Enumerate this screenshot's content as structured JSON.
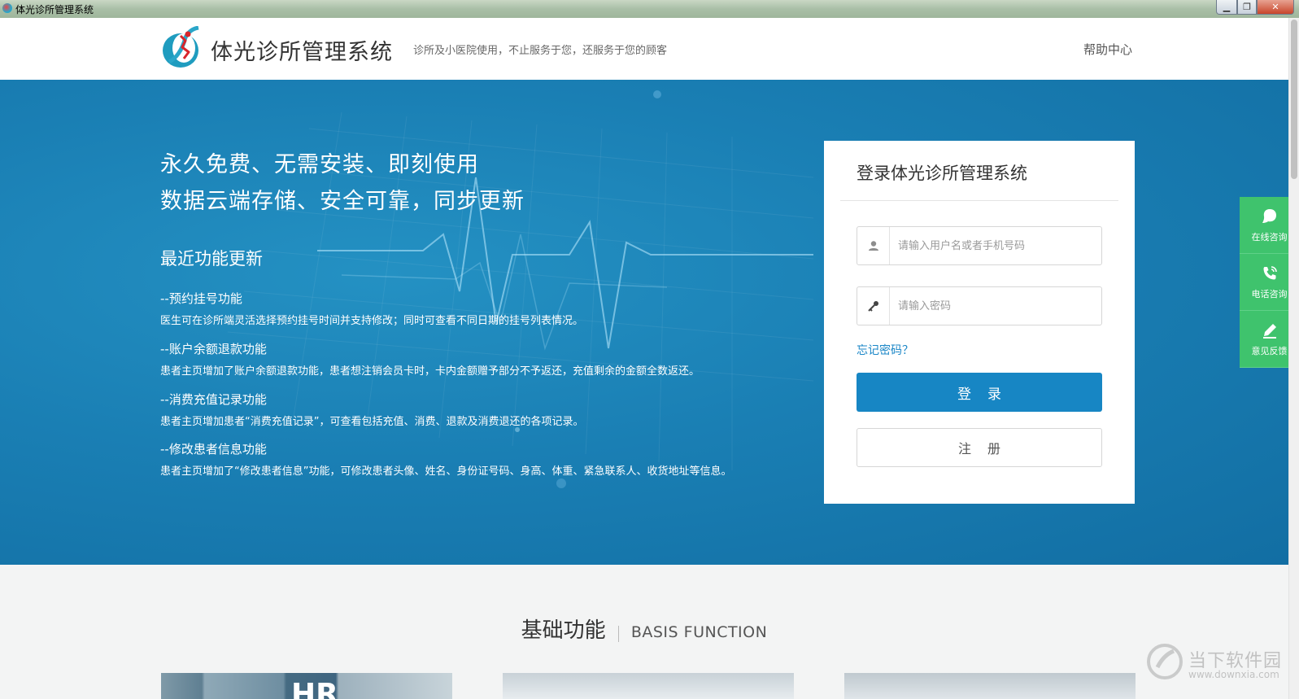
{
  "window": {
    "title": "体光诊所管理系统",
    "controls": {
      "minimize": "▁",
      "maximize": "❐",
      "close": "✕"
    }
  },
  "header": {
    "brand": "体光诊所管理系统",
    "slogan": "诊所及小医院使用，不止服务于您，还服务于您的顾客",
    "help": "帮助中心",
    "logo_icon": "clinic-logo-icon"
  },
  "hero": {
    "heading_1": "永久免费、无需安装、即刻使用",
    "heading_2": "数据云端存储、安全可靠，同步更新",
    "updates_title": "最近功能更新",
    "updates": [
      {
        "name": "--预约挂号功能",
        "desc": "医生可在诊所端灵活选择预约挂号时间并支持修改；同时可查看不同日期的挂号列表情况。"
      },
      {
        "name": "--账户余额退款功能",
        "desc": "患者主页增加了账户余额退款功能，患者想注销会员卡时，卡内金额赠予部分不予返还，充值剩余的金额全数返还。"
      },
      {
        "name": "--消费充值记录功能",
        "desc": "患者主页增加患者“消费充值记录”，可查看包括充值、消费、退款及消费退还的各项记录。"
      },
      {
        "name": "--修改患者信息功能",
        "desc": "患者主页增加了“修改患者信息”功能，可修改患者头像、姓名、身份证号码、身高、体重、紧急联系人、收货地址等信息。"
      }
    ]
  },
  "login": {
    "title": "登录体光诊所管理系统",
    "username_placeholder": "请输入用户名或者手机号码",
    "password_placeholder": "请输入密码",
    "forgot": "忘记密码？",
    "login_button": "登录",
    "register_button": "注册"
  },
  "side": [
    {
      "label": "在线咨询",
      "icon": "chat-bubble-icon"
    },
    {
      "label": "电话咨询",
      "icon": "phone-icon"
    },
    {
      "label": "意见反馈",
      "icon": "pencil-icon"
    }
  ],
  "features": {
    "title_cn": "基础功能",
    "title_en": "BASIS FUNCTION",
    "card_1_text": "HR"
  },
  "watermark": {
    "cn": "当下软件园",
    "en": "www.downxia.com"
  },
  "colors": {
    "primary_blue": "#1786c4",
    "side_green": "#3fc36d",
    "hero_blue": "#1a7fb4"
  }
}
